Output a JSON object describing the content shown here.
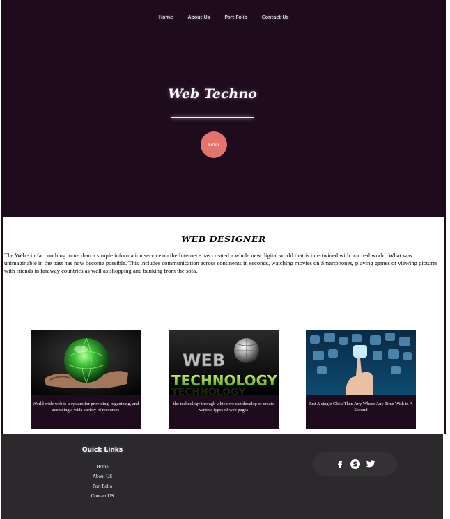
{
  "nav": {
    "items": [
      "Home",
      "About Us",
      "Port Folio",
      "Contact Us"
    ]
  },
  "hero": {
    "title": "Web Techno",
    "enter_label": "Enter"
  },
  "section": {
    "title": "WEB DESIGNER",
    "text": "The Web - in fact nothing more than a simple information service on the Internet - has created a whole new digital world that is intertwined with our real world. What was unimaginable in the past has now become possible. This includes communication across continents in seconds, watching movies on Smartphones, playing games or viewing pictures with friends in faraway countries as well as shopping and banking from the sofa."
  },
  "cards": [
    {
      "caption": "World wide web is a system for providing, organizing, and accessing a wide variety of resources",
      "icon": "glowing-globe-in-hands"
    },
    {
      "caption": "the technology through which we can develop or create various types of web pages",
      "icon": "web-technology-logo"
    },
    {
      "caption": "Just A single Click Then Any Where Any Time With in A Second",
      "icon": "touch-screen-hand"
    }
  ],
  "footer": {
    "quick_links_title": "Quick Links",
    "links": [
      "Home",
      "About US",
      "Port Folio",
      "Contact US"
    ],
    "social": [
      "facebook-icon",
      "skype-icon",
      "twitter-icon"
    ]
  },
  "colors": {
    "hero_bg": "#1f0b1e",
    "enter_button": "#e2746a",
    "footer_bg": "#2b292c"
  }
}
